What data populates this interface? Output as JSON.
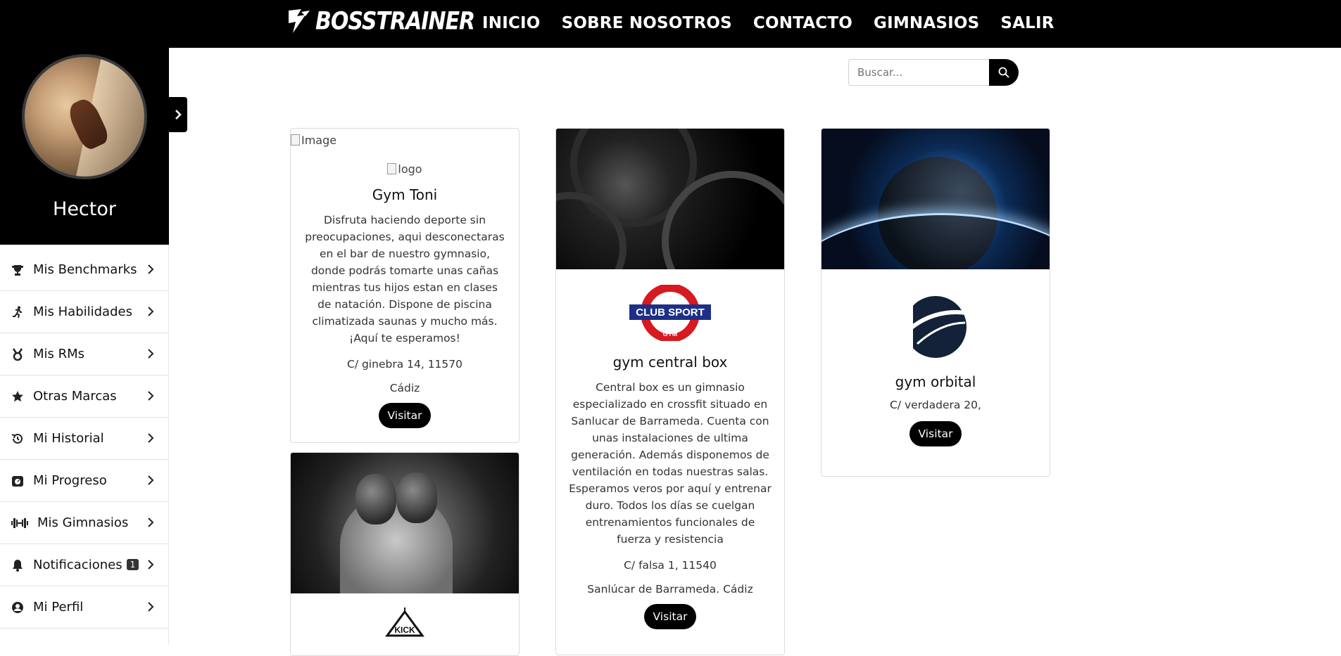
{
  "brand": {
    "name": "BOSSTRAINER"
  },
  "nav": [
    "INICIO",
    "SOBRE NOSOTROS",
    "CONTACTO",
    "GIMNASIOS",
    "SALIR"
  ],
  "user": {
    "name": "Hector"
  },
  "menu": [
    {
      "label": "Mis Benchmarks",
      "icon": "trophy-icon"
    },
    {
      "label": "Mis Habilidades",
      "icon": "running-icon"
    },
    {
      "label": "Mis RMs",
      "icon": "medal-icon"
    },
    {
      "label": "Otras Marcas",
      "icon": "star-icon"
    },
    {
      "label": "Mi Historial",
      "icon": "history-icon"
    },
    {
      "label": "Mi Progreso",
      "icon": "progress-icon"
    },
    {
      "label": "Mis Gimnasios",
      "icon": "dumbbell-icon"
    },
    {
      "label": "Notificaciones",
      "icon": "bell-icon",
      "badge": "1"
    },
    {
      "label": "Mi Perfil",
      "icon": "user-circle-icon"
    }
  ],
  "search": {
    "placeholder": "Buscar..."
  },
  "gyms": [
    {
      "image_alt": "Image",
      "logo_alt": "logo",
      "name": "Gym Toni",
      "description": "Disfruta haciendo deporte sin preocupaciones, aqui desconectaras en el bar de nuestro gymnasio, donde podrás tomarte unas cañas mientras tus hijos estan en clases de natación. Dispone de piscina climatizada saunas y mucho más. ¡Aquí te esperamos!",
      "address": "C/ ginebra 14, 11570",
      "city": "Cádiz",
      "button": "Visitar"
    },
    {
      "logo_text_top": "CLUB SPORT",
      "logo_text_bottom": "GYM",
      "name": "gym central box",
      "description": "Central box es un gimnasio especializado en crossfit situado en Sanlucar de Barrameda. Cuenta con unas instalaciones de ultima generación. Además disponemos de ventilación en todas nuestras salas. Esperamos veros por aquí y entrenar duro. Todos los días se cuelgan entrenamientos funcionales de fuerza y resistencia",
      "address": "C/ falsa 1, 11540",
      "city": "Sanlúcar de Barrameda. Cádiz",
      "button": "Visitar"
    },
    {
      "name": "gym orbital",
      "address": "C/ verdadera 20,",
      "button": "Visitar"
    },
    {
      "logo_text": "KICK"
    }
  ]
}
